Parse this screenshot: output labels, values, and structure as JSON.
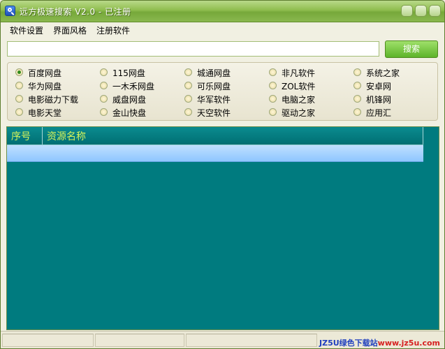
{
  "window": {
    "title": "远方极速搜索 V2.0 - 已注册"
  },
  "menu": [
    "软件设置",
    "界面风格",
    "注册软件"
  ],
  "search": {
    "value": "",
    "placeholder": "",
    "button_label": "搜索"
  },
  "sources": [
    [
      "百度网盘",
      "115网盘",
      "城通网盘",
      "非凡软件",
      "系统之家"
    ],
    [
      "华为网盘",
      "一木禾网盘",
      "可乐网盘",
      "ZOL软件",
      "安卓网"
    ],
    [
      "电影磁力下载",
      "威盘网盘",
      "华军软件",
      "电脑之家",
      "机锋网"
    ],
    [
      "电影天堂",
      "金山快盘",
      "天空软件",
      "驱动之家",
      "应用汇"
    ]
  ],
  "selected_source": "百度网盘",
  "table": {
    "columns": [
      "序号",
      "资源名称"
    ],
    "rows": []
  },
  "watermark": {
    "brand": "JZ5U",
    "cn": "绿色下载站",
    "url": "www.jz5u.com"
  },
  "colors": {
    "titlebar": "#8fbd4e",
    "results_bg": "#007b7f",
    "header_text": "#d4f25a",
    "selected_row": "#9fcfff"
  }
}
